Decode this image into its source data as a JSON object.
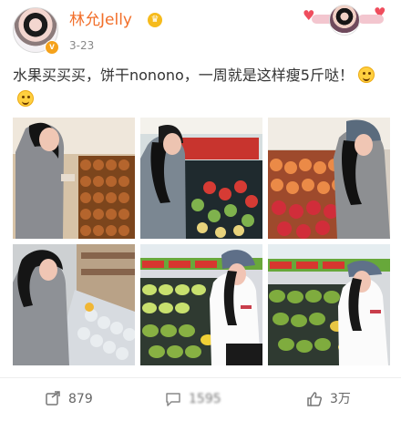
{
  "user": {
    "name": "林允Jelly",
    "post_time": "3-23",
    "verified_icon": "verified-badge-icon",
    "member_icon": "crown-badge-icon"
  },
  "post": {
    "text": "水果买买买，饼干nonono，一周就是这样瘦5斤哒！",
    "emoji": "smile-icon"
  },
  "photos": [
    {
      "label": "photo-1"
    },
    {
      "label": "photo-2"
    },
    {
      "label": "photo-3"
    },
    {
      "label": "photo-4"
    },
    {
      "label": "photo-5"
    },
    {
      "label": "photo-6"
    }
  ],
  "actions": {
    "repost": {
      "icon": "repost-icon",
      "count": "879"
    },
    "comment": {
      "icon": "comment-icon",
      "count": "1595"
    },
    "like": {
      "icon": "like-icon",
      "count": "3万"
    }
  },
  "colors": {
    "username": "#f26f2a",
    "text": "#333333",
    "meta": "#888888",
    "verified": "#f5a21b"
  }
}
